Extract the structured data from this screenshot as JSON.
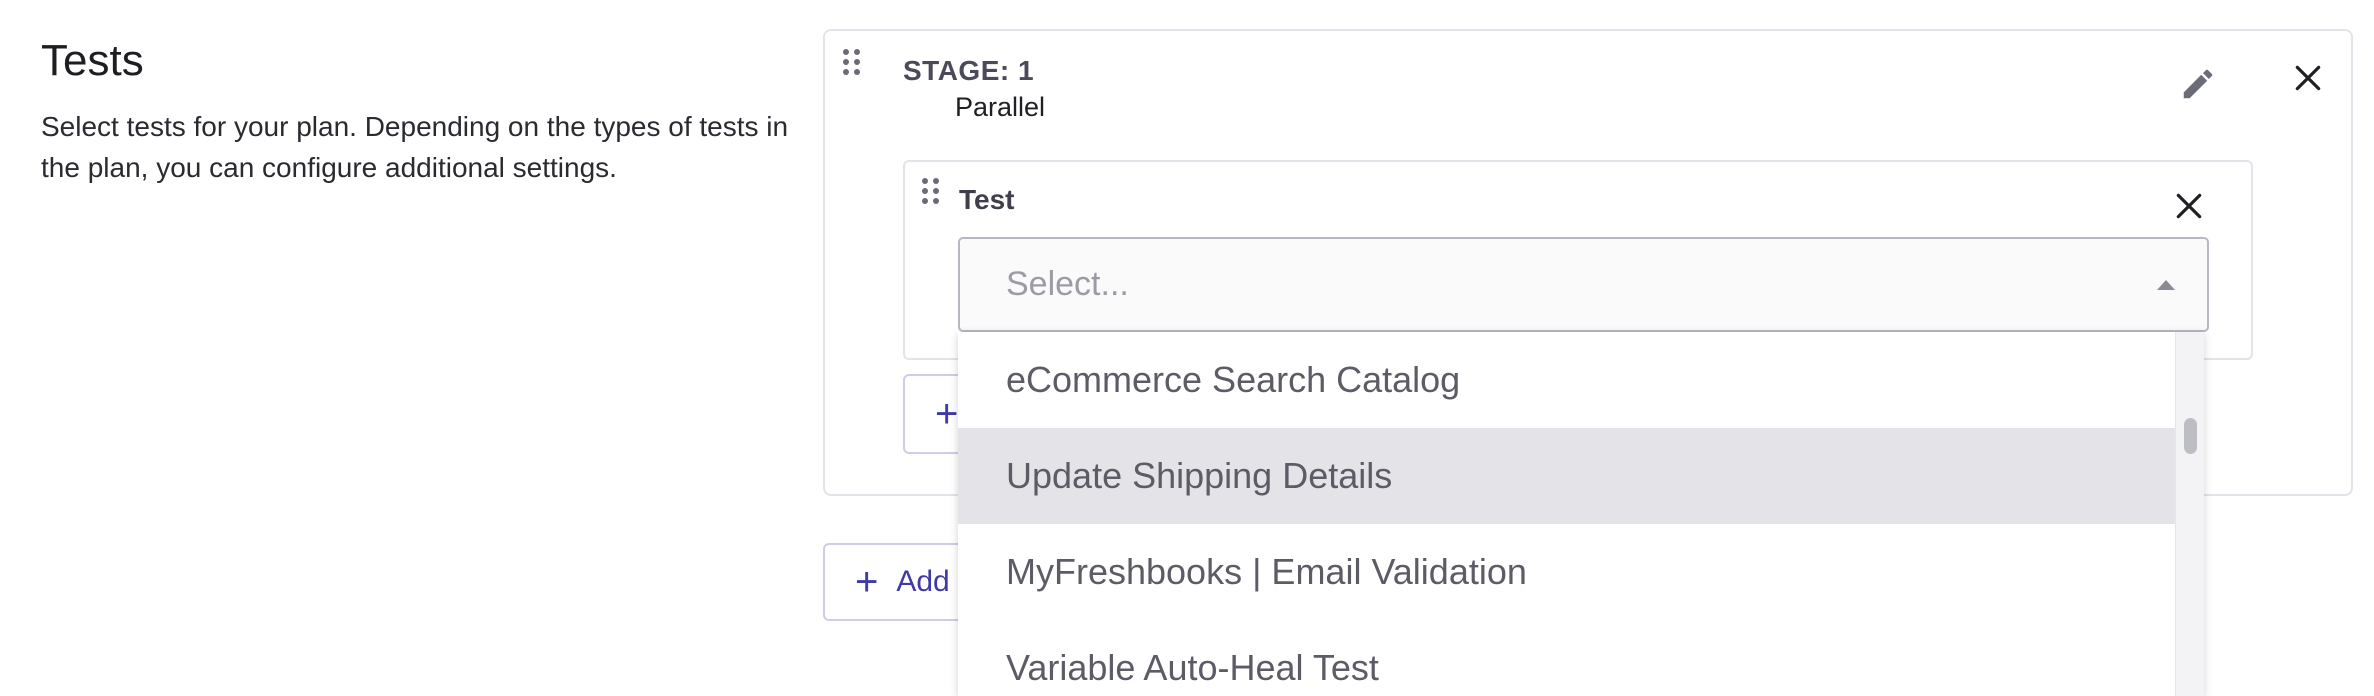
{
  "section": {
    "title": "Tests",
    "description": "Select tests for your plan. Depending on the types of tests in the plan, you can configure additional settings."
  },
  "stage": {
    "label": "STAGE: 1",
    "mode": "Parallel",
    "edit_icon": "pencil-icon",
    "close_icon": "close-icon"
  },
  "test": {
    "label": "Test",
    "close_icon": "close-icon",
    "select": {
      "placeholder": "Select..."
    }
  },
  "add_test_button": {
    "label": "+"
  },
  "add_stage_button": {
    "label": "Add"
  },
  "dropdown": {
    "options": [
      "eCommerce Search Catalog",
      "Update Shipping Details",
      "MyFreshbooks | Email Validation",
      "Variable Auto-Heal Test"
    ],
    "hovered_index": 1
  },
  "colors": {
    "accent": "#3f3aa8",
    "hover_bg": "#e4e4e8",
    "border": "#e3e3ea"
  }
}
